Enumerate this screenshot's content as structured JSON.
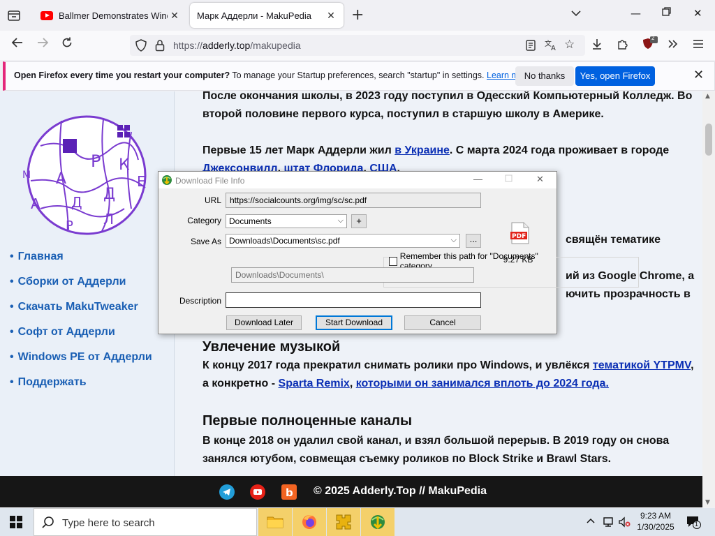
{
  "tabs": [
    {
      "title": "Ballmer Demonstrates Window",
      "active": false
    },
    {
      "title": "Марк Аддерли - MakuPedia",
      "active": true
    }
  ],
  "address_bar": {
    "url_prefix": "https://",
    "url_domain": "adderly.top",
    "url_path": "/makupedia"
  },
  "notification": {
    "bold_text": "Open Firefox every time you restart your computer?",
    "body_text": " To manage your Startup preferences, search \"startup\" in settings. ",
    "learn_more": "Learn more",
    "no_thanks": "No thanks",
    "yes_button": "Yes, open Firefox",
    "accent_color": "#e4267a"
  },
  "sidebar": {
    "logo_letters": [
      "М",
      "А",
      "Р",
      "К",
      "А",
      "Д",
      "Д",
      "Е",
      "Р",
      "Л"
    ],
    "items": [
      "Главная",
      "Сборки от Аддерли",
      "Скачать MakuTweaker",
      "Софт от Аддерли",
      "Windows PE от Аддерли",
      "Поддержать"
    ]
  },
  "content": {
    "p1": "После окончания школы, в 2023 году поступил в Одесский Компьютерный Колледж. Во второй половине первого курса, поступил в старшую школу в Америке.",
    "p2_a": "Первые 15 лет Марк Аддерли жил ",
    "p2_link1": "в Украине",
    "p2_b": ". С марта 2024 года проживает в городе ",
    "p2_link2": "Джексонвилл",
    "p2_c": ", ",
    "p2_link3": "штат Флорида",
    "p2_d": ". ",
    "p2_link4": "США",
    "p2_e": ".",
    "frag1": "свящён тематике",
    "frag2a": "ий из Google Chrome, а",
    "frag2b": "ючить прозрачность в",
    "h_music": "Увлечение музыкой",
    "p3_a": "К концу 2017 года прекратил снимать ролики про Windows, и увлёкся ",
    "p3_link1": "тематикой YTPMV",
    "p3_b": ", а конкретно - ",
    "p3_link2": "Sparta Remix",
    "p3_c": ", ",
    "p3_link3": "которыми он занимался вплоть до 2024 года.",
    "h_channels": "Первые полноценные каналы",
    "p4": "В конце 2018 он удалил свой канал, и взял большой перерыв. В 2019 году он снова занялся ютубом, совмещая съемку роликов по Block Strike и Brawl Stars."
  },
  "footer": {
    "copyright": "© 2025 Adderly.Top // MakuPedia"
  },
  "dialog": {
    "title": "Download File Info",
    "url_label": "URL",
    "url_value": "https://socialcounts.org/img/sc/sc.pdf",
    "category_label": "Category",
    "category_value": "Documents",
    "add_label": "+",
    "saveas_label": "Save As",
    "saveas_value": "Downloads\\Documents\\sc.pdf",
    "browse_label": "...",
    "remember_label": "Remember this path for \"Documents\" category",
    "remember_path": "Downloads\\Documents\\",
    "description_label": "Description",
    "description_value": "",
    "file_size": "9.27  KB",
    "btn_later": "Download Later",
    "btn_start": "Start Download",
    "btn_cancel": "Cancel"
  },
  "taskbar": {
    "search_placeholder": "Type here to search",
    "time": "9:23 AM",
    "date": "1/30/2025",
    "notification_count": "1"
  },
  "toolbar": {
    "extension_badge": "2"
  }
}
